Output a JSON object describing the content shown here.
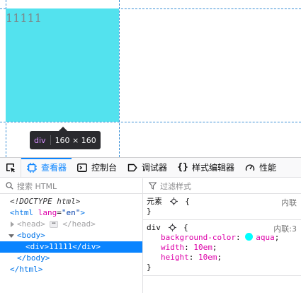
{
  "viewport": {
    "element_text": "11111",
    "element_color": "#53e2ee",
    "tooltip": {
      "tag": "div",
      "size": "160 × 160"
    }
  },
  "toolbox": {
    "tabs": [
      {
        "id": "inspector",
        "label": "查看器",
        "icon": "inspector-icon",
        "selected": true
      },
      {
        "id": "console",
        "label": "控制台",
        "icon": "console-icon"
      },
      {
        "id": "debugger",
        "label": "调试器",
        "icon": "debugger-icon"
      },
      {
        "id": "style-editor",
        "label": "样式编辑器",
        "icon": "braces-icon"
      },
      {
        "id": "performance",
        "label": "性能",
        "icon": "performance-icon"
      }
    ],
    "accent_color": "#0a84ff"
  },
  "markup": {
    "search_placeholder": "搜索 HTML",
    "doctype": "<!DOCTYPE html>",
    "html_open": "<html",
    "lang_attr": "lang",
    "lang_val": "\"en\"",
    "tag_close": ">",
    "head_open": "<head>",
    "head_close": "</head>",
    "ellipsis": "⋯",
    "body_open": "<body>",
    "div_line": "<div>11111</div>",
    "body_close": "</body>",
    "html_close": "</html>"
  },
  "rules": {
    "filter_placeholder": "过滤样式",
    "element_rule": {
      "selector": "元素",
      "open": "{",
      "close": "}",
      "source": "内联"
    },
    "div_rule": {
      "selector": "div",
      "open": "{",
      "close": "}",
      "source": "内联:3",
      "declarations": [
        {
          "name": "background-color",
          "value": "aqua",
          "swatch": "#00ffff"
        },
        {
          "name": "width",
          "value": "10em"
        },
        {
          "name": "height",
          "value": "10em"
        }
      ]
    }
  }
}
